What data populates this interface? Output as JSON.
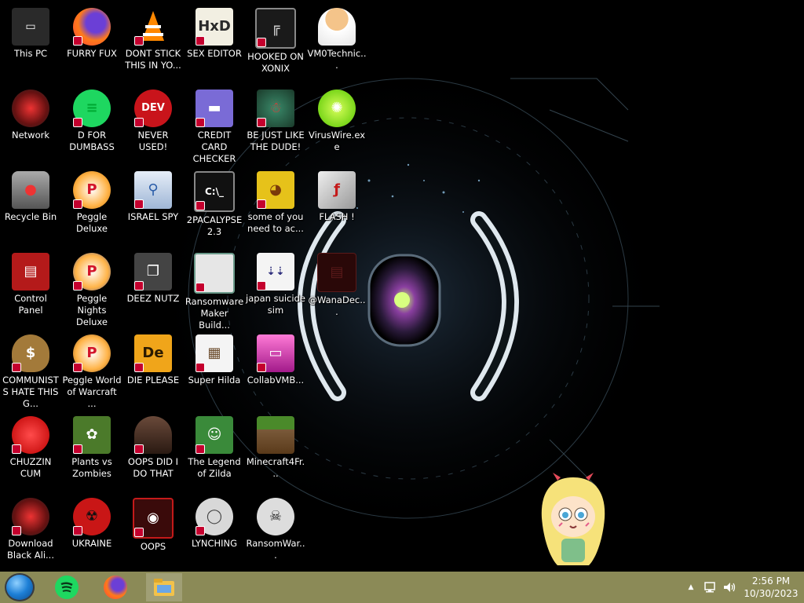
{
  "desktop": {
    "icons": [
      {
        "label": "This PC",
        "icon": "computer-icon"
      },
      {
        "label": "Network",
        "icon": "network-icon"
      },
      {
        "label": "Recycle Bin",
        "icon": "recycle-bin-icon"
      },
      {
        "label": "Control Panel",
        "icon": "control-panel-icon"
      },
      {
        "label": "COMMUNISTS HATE THIS G...",
        "icon": "money-bag-icon"
      },
      {
        "label": "CHUZZIN CUM",
        "icon": "chuzzle-icon"
      },
      {
        "label": "Download Black Ali...",
        "icon": "alien-icon"
      },
      {
        "label": "FURRY FUX",
        "icon": "firefox-icon"
      },
      {
        "label": "D FOR DUMBASS",
        "icon": "spotify-icon"
      },
      {
        "label": "Peggle Deluxe",
        "icon": "peggle-icon"
      },
      {
        "label": "Peggle Nights Deluxe",
        "icon": "peggle-icon"
      },
      {
        "label": "Peggle World of Warcraft ...",
        "icon": "peggle-icon"
      },
      {
        "label": "Plants vs Zombies",
        "icon": "flower-icon"
      },
      {
        "label": "UKRAINE",
        "icon": "radiation-icon"
      },
      {
        "label": "DONT STICK THIS IN YO...",
        "icon": "vlc-cone-icon"
      },
      {
        "label": "NEVER USED!",
        "icon": "dev-cpp-icon"
      },
      {
        "label": "ISRAEL SPY",
        "icon": "spy-icon"
      },
      {
        "label": "DEEZ NUTZ",
        "icon": "stack-windows-icon"
      },
      {
        "label": "DIE PLEASE",
        "icon": "de-icon"
      },
      {
        "label": "OOPS DID I DO THAT",
        "icon": "portrait-icon"
      },
      {
        "label": "OOPS",
        "icon": "oops-icon"
      },
      {
        "label": "SEX EDITOR",
        "icon": "hxd-icon"
      },
      {
        "label": "CREDIT CARD CHECKER",
        "icon": "credit-card-icon"
      },
      {
        "label": "2PACALYPSE 2.3",
        "icon": "terminal-icon"
      },
      {
        "label": "Ransomware Maker Build...",
        "icon": "window-icon"
      },
      {
        "label": "Super Hilda",
        "icon": "pixel-game-icon"
      },
      {
        "label": "The Legend of Zilda",
        "icon": "zelda-icon"
      },
      {
        "label": "LYNCHING",
        "icon": "noose-icon"
      },
      {
        "label": "HOOKED ON XONIX",
        "icon": "xonix-icon"
      },
      {
        "label": "BE JUST LIKE THE DUDE!",
        "icon": "santa-icon"
      },
      {
        "label": "some of you need to ac...",
        "icon": "dog-icon"
      },
      {
        "label": "japan suicide sim",
        "icon": "japan-sim-icon"
      },
      {
        "label": "CollabVMB...",
        "icon": "monitor-icon"
      },
      {
        "label": "Minecraft4Fr...",
        "icon": "grass-block-icon"
      },
      {
        "label": "RansomWar...",
        "icon": "skull-icon"
      },
      {
        "label": "VM0Technic...",
        "icon": "doctor-icon"
      },
      {
        "label": "VirusWire.exe",
        "icon": "lime-icon"
      },
      {
        "label": "FLASH !",
        "icon": "flash-icon"
      },
      {
        "label": "@WanaDec...",
        "icon": "wannacry-icon"
      }
    ]
  },
  "taskbar": {
    "pinned": [
      {
        "name": "spotify-icon"
      },
      {
        "name": "firefox-icon"
      },
      {
        "name": "file-explorer-icon"
      }
    ],
    "clock": {
      "time": "2:56 PM",
      "date": "10/30/2023"
    }
  }
}
